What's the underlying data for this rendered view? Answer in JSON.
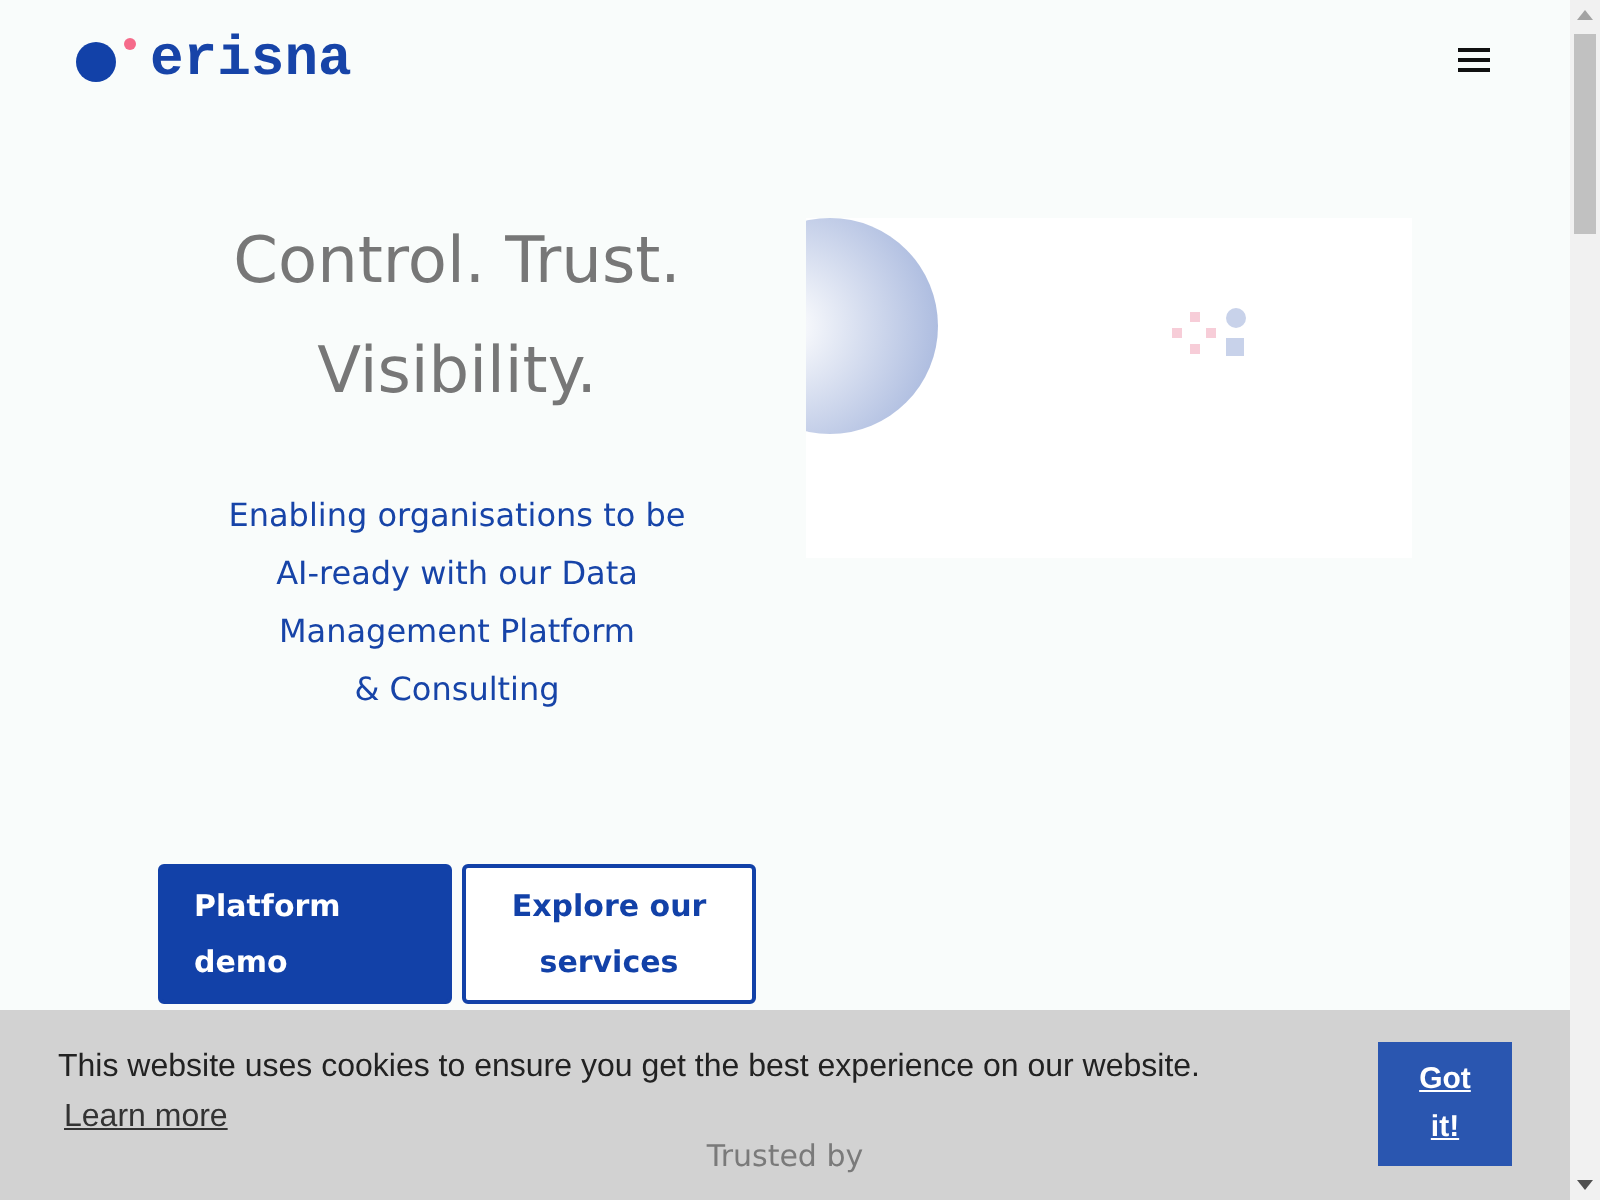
{
  "header": {
    "logo": "erisna"
  },
  "hero": {
    "title_lines": [
      "Control. Trust.",
      "Visibility."
    ],
    "subtitle_lines": [
      "Enabling organisations to be",
      "AI-ready with our Data",
      "Management Platform",
      "& Consulting"
    ],
    "buttons": [
      {
        "label": "Platform demo",
        "kind": "primary"
      },
      {
        "label": "Explore our services",
        "kind": "outline"
      }
    ]
  },
  "trusted": {
    "heading": "Trusted by"
  },
  "cookie_banner": {
    "message": "This website uses cookies to ensure you get the best experience on our website.",
    "link": "Learn more",
    "button": "Got it!"
  }
}
